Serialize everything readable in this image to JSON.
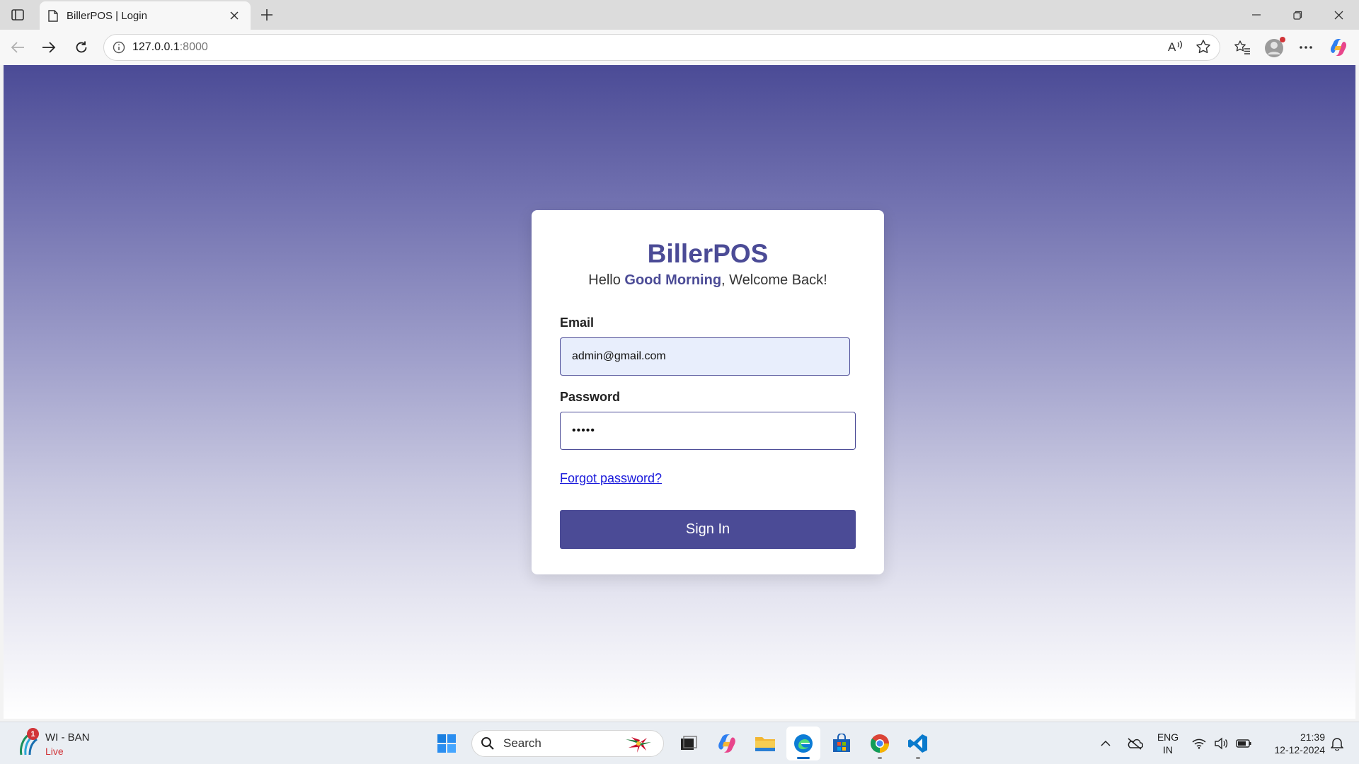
{
  "browser": {
    "tab_title": "BillerPOS | Login",
    "url_host": "127.0.0.1",
    "url_port": ":8000"
  },
  "login": {
    "app_name": "BillerPOS",
    "greeting_prefix": "Hello ",
    "greeting_emphasis": "Good Morning",
    "greeting_suffix": ", Welcome Back!",
    "email_label": "Email",
    "email_value": "admin@gmail.com",
    "password_label": "Password",
    "password_value": "•••••",
    "forgot_label": "Forgot password?",
    "signin_label": "Sign In"
  },
  "taskbar": {
    "weather_title": "WI - BAN",
    "weather_sub": "Live",
    "weather_badge": "1",
    "search_placeholder": "Search",
    "lang_line1": "ENG",
    "lang_line2": "IN",
    "time": "21:39",
    "date": "12-12-2024"
  },
  "colors": {
    "brand": "#4b4b96",
    "link": "#1a1adb",
    "email_field_bg": "#e8eefc"
  },
  "icons": [
    "sidebar-icon",
    "page-icon",
    "close-icon",
    "plus-icon",
    "minimize-icon",
    "restore-icon",
    "back-icon",
    "forward-icon",
    "refresh-icon",
    "info-icon",
    "read-aloud-icon",
    "star-icon",
    "favorites-icon",
    "profile-icon",
    "more-icon",
    "copilot-icon",
    "windows-start-icon",
    "search-icon",
    "task-view-icon",
    "file-explorer-icon",
    "edge-icon",
    "store-icon",
    "chrome-icon",
    "vscode-icon",
    "chevron-up-icon",
    "onedrive-icon",
    "wifi-icon",
    "volume-icon",
    "battery-icon",
    "bell-icon"
  ]
}
